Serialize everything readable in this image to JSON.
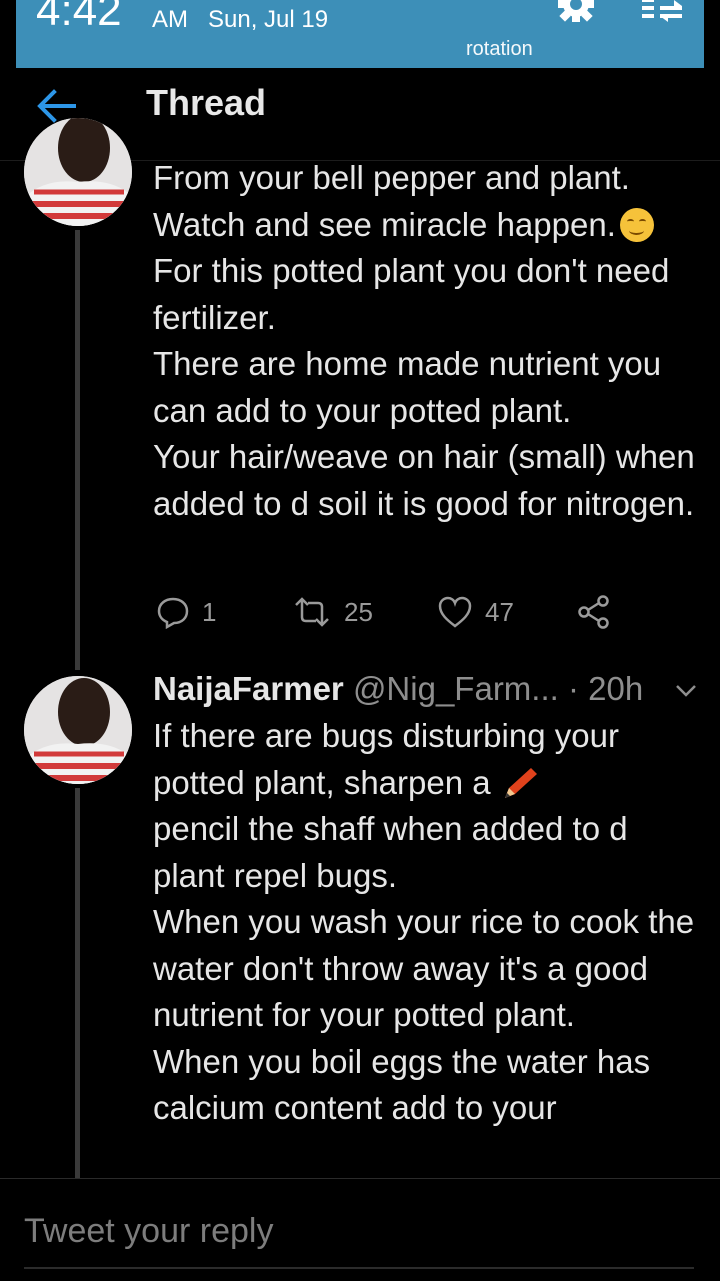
{
  "status_bar": {
    "time": "4:42",
    "ampm": "AM",
    "date": "Sun, Jul 19",
    "rotation_label": "rotation"
  },
  "header": {
    "title": "Thread"
  },
  "tweets": [
    {
      "lines": [
        "From your bell pepper and plant.",
        "Watch and see miracle happen.",
        "For this potted plant you don't need fertilizer.",
        "There are home made nutrient you can add to your potted plant.",
        "Your hair/weave on hair (small) when added to d soil it is good for nitrogen."
      ],
      "actions": {
        "replies": "1",
        "retweets": "25",
        "likes": "47"
      }
    },
    {
      "name": "NaijaFarmer",
      "handle": "@Nig_Farm...",
      "time": "· 20h",
      "lines": [
        "If there are bugs disturbing your potted plant, sharpen a",
        "pencil the shaff when added to d plant repel bugs.",
        "When you wash your rice to cook the water don't throw away it's a good nutrient for your potted plant.",
        "When you boil eggs the water has calcium content add to your"
      ]
    }
  ],
  "reply": {
    "placeholder": "Tweet your reply"
  }
}
